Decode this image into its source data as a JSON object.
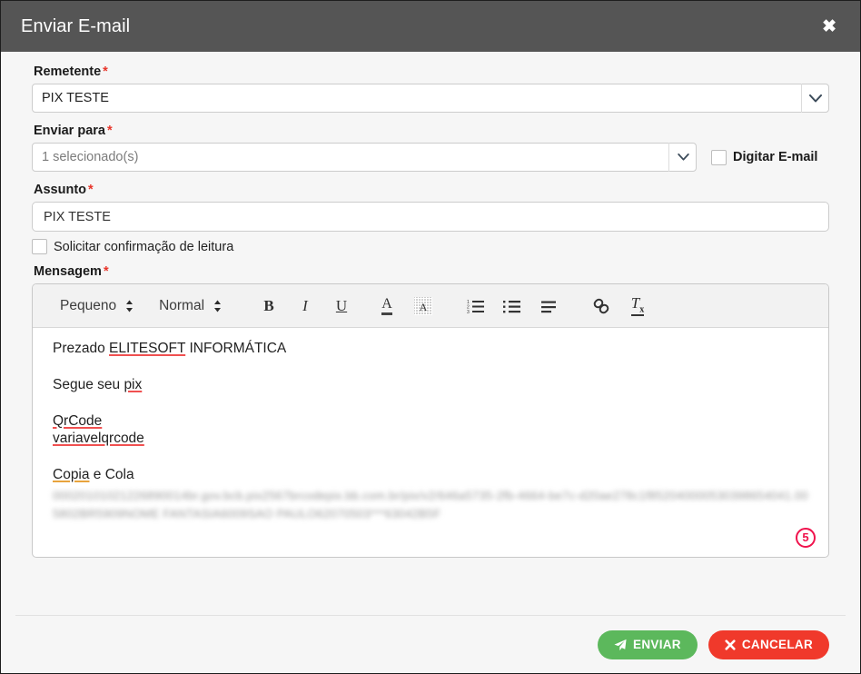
{
  "dialog": {
    "title": "Enviar E-mail",
    "close_icon": "close-icon"
  },
  "form": {
    "sender": {
      "label": "Remetente",
      "required_mark": "*",
      "value": "PIX TESTE",
      "arrow_icon": "chevron-down-icon"
    },
    "recipients": {
      "label": "Enviar para",
      "required_mark": "*",
      "value": "1 selecionado(s)",
      "arrow_icon": "chevron-down-icon"
    },
    "type_email": {
      "label": "Digitar E-mail",
      "checked": false
    },
    "subject": {
      "label": "Assunto",
      "required_mark": "*",
      "value": "PIX TESTE",
      "placeholder": ""
    },
    "read_receipt": {
      "label": "Solicitar confirmação de leitura",
      "checked": false
    },
    "message": {
      "label": "Mensagem",
      "required_mark": "*"
    }
  },
  "toolbar": {
    "font_size": "Pequeno",
    "font_style": "Normal",
    "bold": "B",
    "italic": "I",
    "underline": "U",
    "text_color": "A",
    "highlight": "A",
    "ordered_list_icon": "ordered-list-icon",
    "bullet_list_icon": "bullet-list-icon",
    "align_icon": "align-left-icon",
    "link_icon": "link-icon",
    "clear_format": "Tx"
  },
  "editor": {
    "line1_prefix": "Prezado ",
    "line1_misspelled": "ELITESOFT",
    "line1_suffix": " INFORMÁTICA",
    "line2_prefix": "Segue seu ",
    "line2_misspelled": "pix",
    "line3": "QrCode",
    "line4": "variavelqrcode",
    "line5_misspelled": "Copia",
    "line5_suffix": " e Cola",
    "pix_code": "00020101021226890014br.gov.bcb.pix2567brcodepix.bb.com.br/pix/v2/646a5735-2fb-4664-be7c-d20ae278c1f852040000530398654041.005802BR5909NOME FANTASIA6009SAO PAULO62070503***63042B5F",
    "badge": "5"
  },
  "footer": {
    "send_label": "ENVIAR",
    "send_icon": "paper-plane-icon",
    "send_color": "#5cb85c",
    "cancel_label": "CANCELAR",
    "cancel_icon": "close-x-icon",
    "cancel_color": "#f0392b"
  }
}
